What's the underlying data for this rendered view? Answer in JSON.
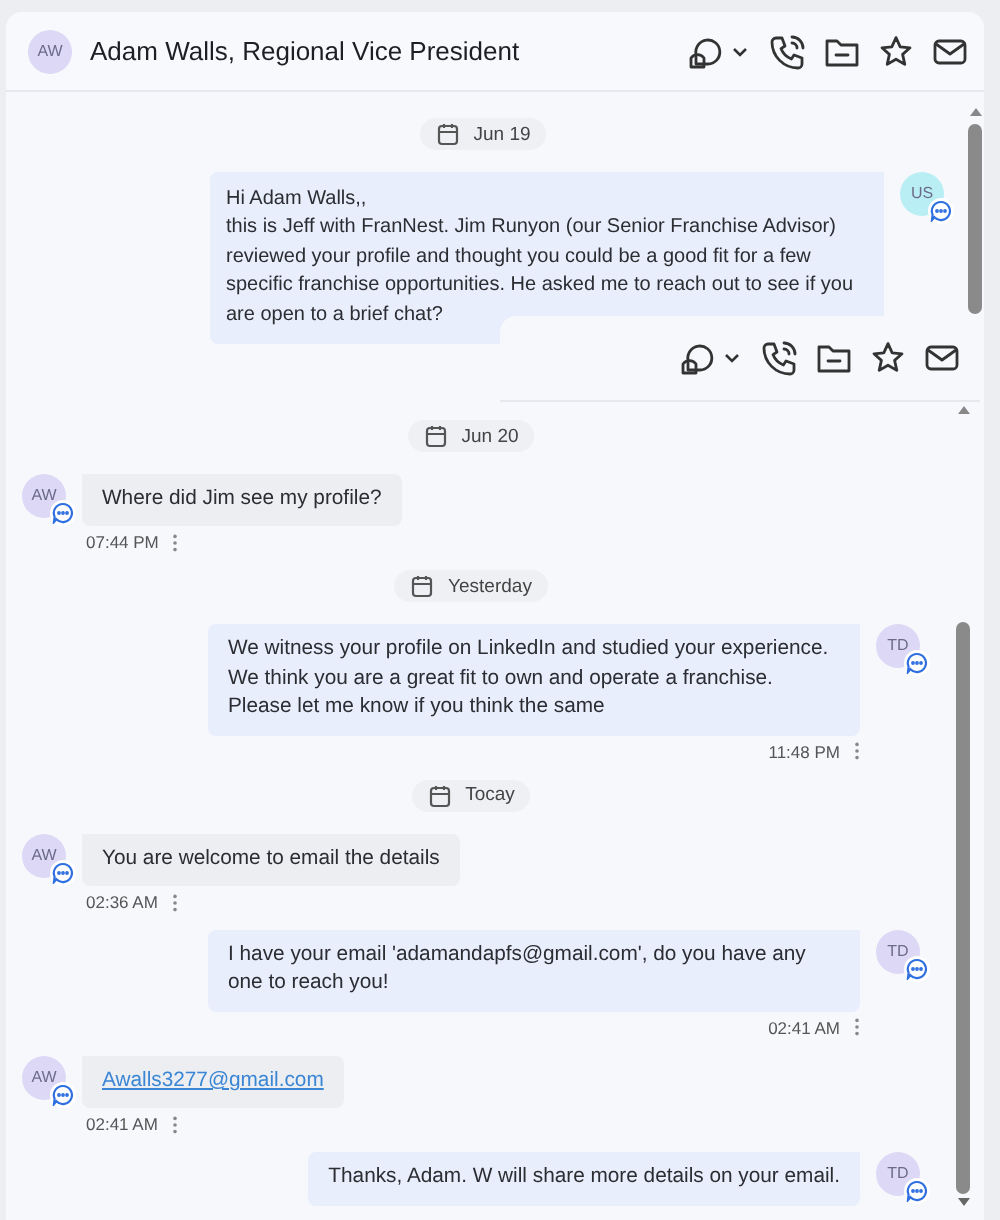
{
  "header": {
    "avatar": "AW",
    "title": "Adam Walls, Regional Vice President"
  },
  "top_items": [
    {
      "kind": "date",
      "label": "Jun 19"
    },
    {
      "kind": "sent",
      "avatar": "US",
      "color": "#b8eef4",
      "text": "Hi Adam Walls,,\nthis is Jeff with FranNest. Jim Runyon (our Senior Franchise Advisor) reviewed your profile and thought you could be a good fit for a few specific franchise opportunities. He asked me to reach out to see if you are open to a brief chat?"
    }
  ],
  "lower_items": [
    {
      "kind": "date",
      "label": "Jun 20"
    },
    {
      "kind": "received",
      "avatar": "AW",
      "color": "#dcd8f6",
      "text": "Where did Jim see my profile?",
      "time": "07:44 PM"
    },
    {
      "kind": "date",
      "label": "Yesterday"
    },
    {
      "kind": "sent",
      "avatar": "TD",
      "color": "#dcd8f6",
      "text": "We witness your profile on LinkedIn and studied your experience. We think you are a great fit to own and operate a franchise. Please let me know if you think the same",
      "time": "11:48 PM"
    },
    {
      "kind": "date",
      "label": "Tocay"
    },
    {
      "kind": "received",
      "avatar": "AW",
      "color": "#dcd8f6",
      "text": "You are welcome to email the details",
      "time": "02:36 AM"
    },
    {
      "kind": "sent",
      "avatar": "TD",
      "color": "#dcd8f6",
      "text": "I have your email 'adamandapfs@gmail.com', do you have any one to reach you!",
      "time": "02:41 AM"
    },
    {
      "kind": "received_link",
      "avatar": "AW",
      "color": "#dcd8f6",
      "text": "Awalls3277@gmail.com",
      "time": "02:41 AM"
    },
    {
      "kind": "sent",
      "avatar": "TD",
      "color": "#dcd8f6",
      "text": "Thanks, Adam. W will share more details on your email."
    }
  ]
}
